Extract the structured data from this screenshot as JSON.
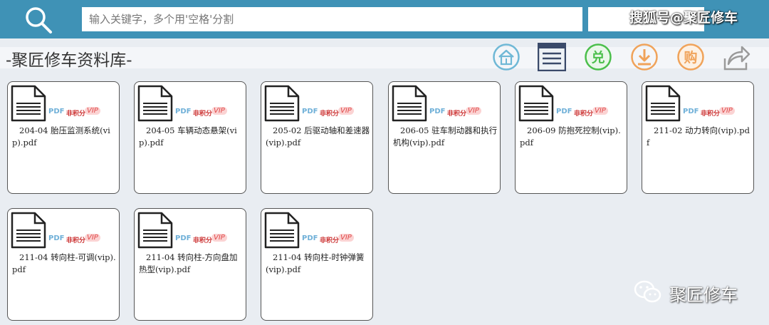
{
  "search": {
    "placeholder": "输入关键字，多个用'空格'分割"
  },
  "watermarks": {
    "top": "搜狐号@聚匠修车",
    "bottom": "聚匠修车"
  },
  "page": {
    "title": "-聚匠修车资料库-"
  },
  "toolbar": {
    "exchange_label": "兑",
    "buy_label": "购",
    "items": [
      "home-icon",
      "menu-icon",
      "exchange-icon",
      "download-icon",
      "buy-icon",
      "share-icon"
    ]
  },
  "badges": {
    "format": "PDF",
    "free": "非积分",
    "vip": "VIP"
  },
  "files": [
    {
      "name": "204-04 胎压监测系统(vip).pdf"
    },
    {
      "name": "204-05 车辆动态悬架(vip).pdf"
    },
    {
      "name": "205-02 后驱动轴和差速器(vip).pdf"
    },
    {
      "name": "206-05 驻车制动器和执行机构(vip).pdf"
    },
    {
      "name": "206-09 防抱死控制(vip).pdf"
    },
    {
      "name": "211-02 动力转向(vip).pdf"
    },
    {
      "name": "211-04 转向柱-可调(vip).pdf"
    },
    {
      "name": "211-04 转向柱-方向盘加热型(vip).pdf"
    },
    {
      "name": "211-04 转向柱-时钟弹簧(vip).pdf"
    }
  ],
  "colors": {
    "topbar": "#3f92b6",
    "home": "#6fb8d6",
    "exchange": "#4bbf4b",
    "download": "#f0a35a",
    "buy": "#f0a35a",
    "share": "#9a9a9a"
  }
}
